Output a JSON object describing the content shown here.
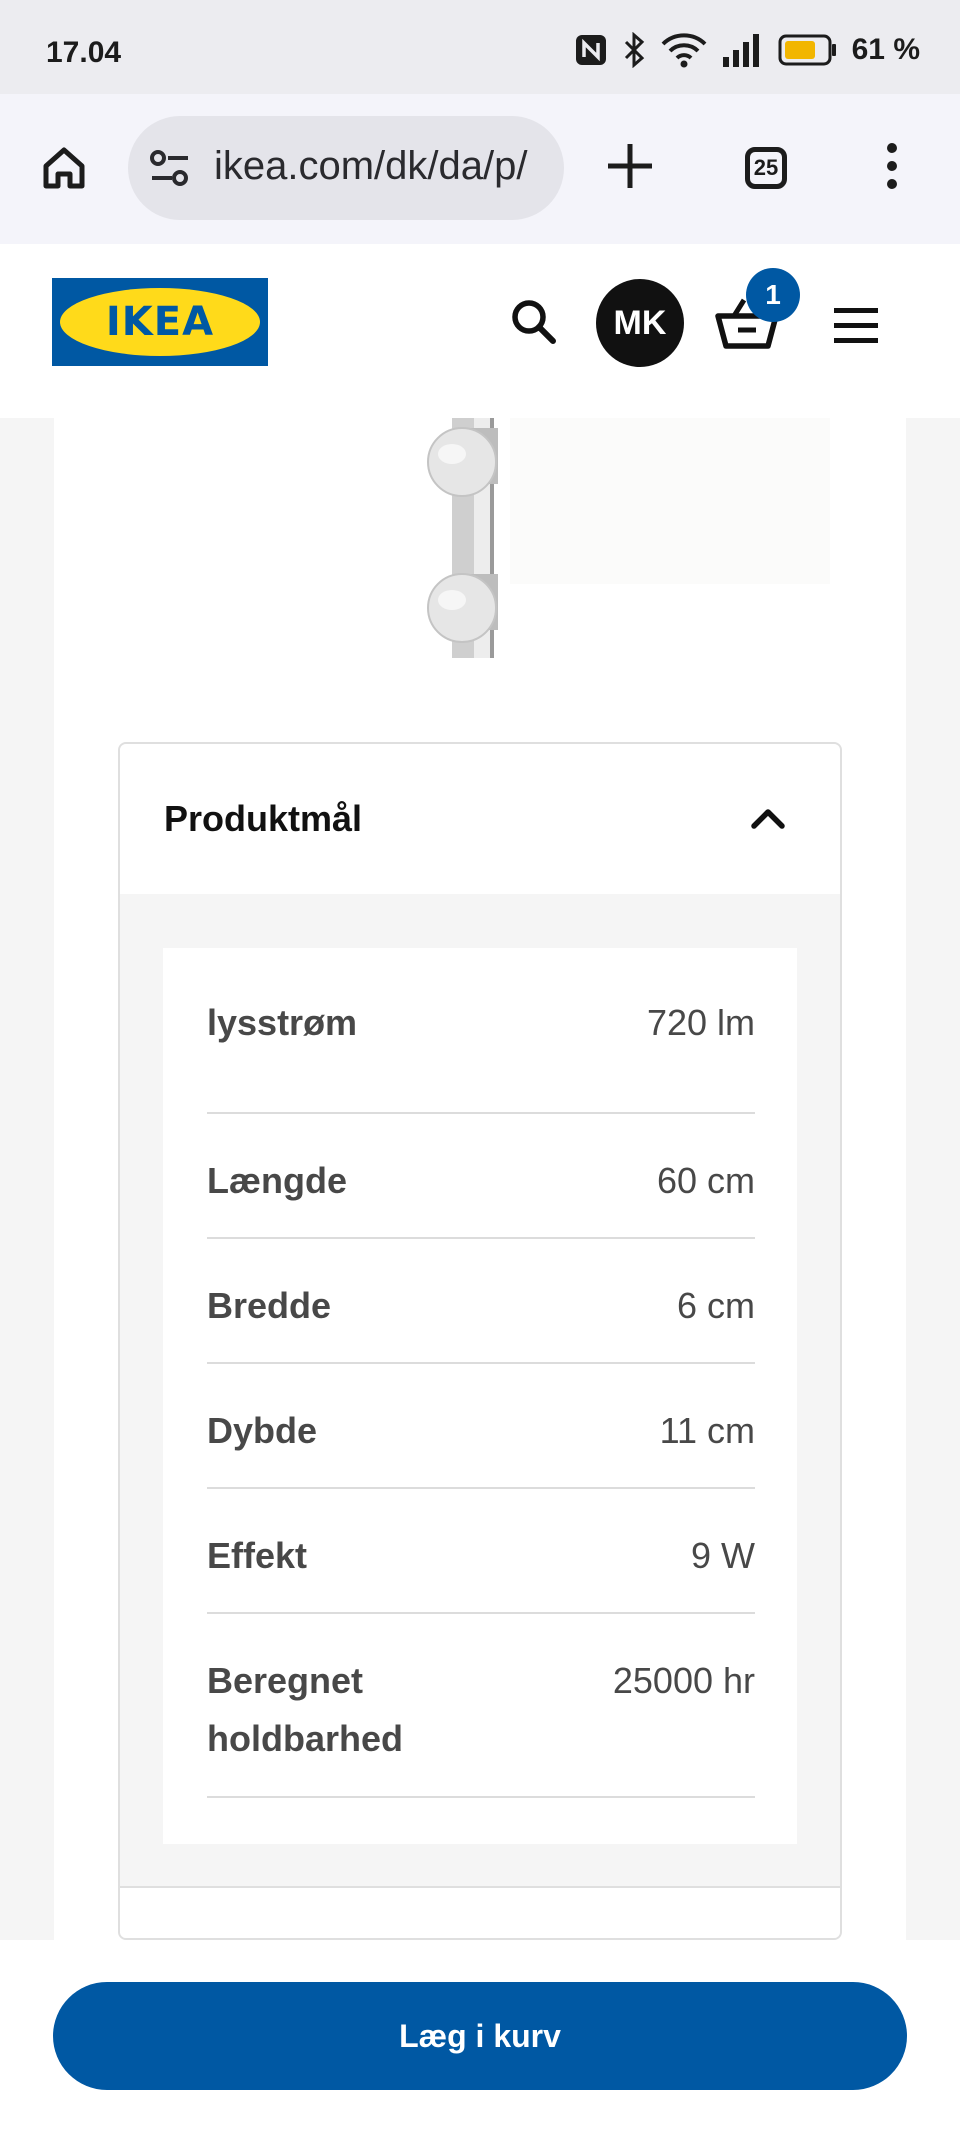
{
  "status_bar": {
    "time": "17.04",
    "battery_text": "61 %",
    "icons": [
      "nfc-icon",
      "bluetooth-icon",
      "wifi-icon",
      "signal-icon",
      "battery-icon"
    ]
  },
  "browser": {
    "url": "ikea.com/dk/da/p/",
    "tab_count": "25",
    "icons": [
      "home-icon",
      "site-settings-icon",
      "new-tab-icon",
      "tab-switcher-icon",
      "more-icon"
    ]
  },
  "header": {
    "logo_text": "IKEA",
    "avatar_initials": "MK",
    "cart_count": "1",
    "icons": [
      "search-icon",
      "cart-icon",
      "menu-icon"
    ]
  },
  "accordion": {
    "title": "Produktmål",
    "expanded": true,
    "specs": [
      {
        "label": "lysstrøm",
        "value": "720 lm"
      },
      {
        "label": "Længde",
        "value": "60 cm"
      },
      {
        "label": "Bredde",
        "value": "6 cm"
      },
      {
        "label": "Dybde",
        "value": "11 cm"
      },
      {
        "label": "Effekt",
        "value": "9 W"
      },
      {
        "label": "Beregnet holdbarhed",
        "value": "25000 hr"
      }
    ]
  },
  "cta": {
    "label": "Læg i kurv"
  },
  "colors": {
    "ikea_blue": "#0058a3",
    "ikea_yellow": "#ffda1a",
    "text_dark": "#111111",
    "text_secondary": "#484848"
  }
}
